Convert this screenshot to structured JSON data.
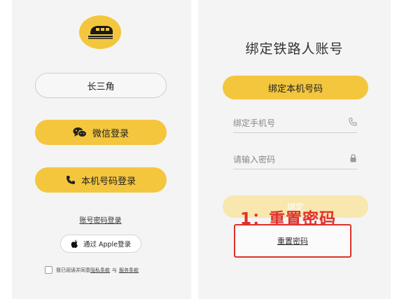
{
  "left_panel": {
    "logo_icon": "train-icon",
    "region_button": "长三角",
    "wechat_login": "微信登录",
    "wechat_icon": "wechat-icon",
    "phone_login": "本机号码登录",
    "phone_icon": "phone-icon",
    "account_login": "账号密码登录",
    "apple_login": "通过 Apple登录",
    "apple_icon": "apple-icon",
    "agree_prefix": "我已阅读并同意",
    "privacy_link": "隐私条款",
    "agree_and": "与",
    "service_link": "服务条款"
  },
  "right_panel": {
    "title": "绑定铁路人账号",
    "bind_phone_button": "绑定本机号码",
    "phone_field_placeholder": "绑定手机号",
    "password_field_placeholder": "请输入密码",
    "bind_button": "绑定",
    "annotation": "1：重置密码",
    "reset_password_link": "重置密码"
  },
  "colors": {
    "accent_yellow": "#f4c63d",
    "disabled_yellow": "#f8e7ae",
    "annotation_red": "#e0302b",
    "panel_bg": "#f4f4f4"
  }
}
